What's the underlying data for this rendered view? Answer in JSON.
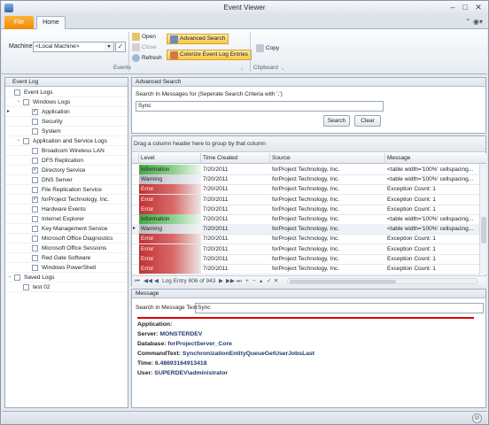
{
  "window": {
    "title": "Event Viewer"
  },
  "tabs": {
    "file": "File",
    "home": "Home"
  },
  "ribbon": {
    "machine_label": "Machine",
    "machine_value": "<Local Machine>",
    "open": "Open",
    "close": "Close",
    "refresh": "Refresh",
    "advanced_search": "Advanced Search",
    "colorize": "Colorize Event Log Entries",
    "copy": "Copy",
    "events_group": "Events",
    "clipboard_group": "Clipboard"
  },
  "event_log": {
    "header": "Event Log",
    "items": [
      {
        "label": "Event Logs",
        "depth": 0,
        "checked": false,
        "expander": ""
      },
      {
        "label": "Windows Logs",
        "depth": 1,
        "checked": false,
        "expander": "−"
      },
      {
        "label": "Application",
        "depth": 2,
        "checked": true,
        "expander": ""
      },
      {
        "label": "Security",
        "depth": 2,
        "checked": false,
        "expander": ""
      },
      {
        "label": "System",
        "depth": 2,
        "checked": false,
        "expander": ""
      },
      {
        "label": "Application and Service Logs",
        "depth": 1,
        "checked": false,
        "expander": "−"
      },
      {
        "label": "Broadcom Wireless LAN",
        "depth": 2,
        "checked": false,
        "expander": ""
      },
      {
        "label": "DFS Replication",
        "depth": 2,
        "checked": false,
        "expander": ""
      },
      {
        "label": "Directory Service",
        "depth": 2,
        "checked": true,
        "expander": ""
      },
      {
        "label": "DNS Server",
        "depth": 2,
        "checked": false,
        "expander": ""
      },
      {
        "label": "File Replication Service",
        "depth": 2,
        "checked": false,
        "expander": ""
      },
      {
        "label": "forProject Technology, Inc.",
        "depth": 2,
        "checked": true,
        "expander": ""
      },
      {
        "label": "Hardware Events",
        "depth": 2,
        "checked": false,
        "expander": ""
      },
      {
        "label": "Internet Explorer",
        "depth": 2,
        "checked": false,
        "expander": ""
      },
      {
        "label": "Key Management Service",
        "depth": 2,
        "checked": false,
        "expander": ""
      },
      {
        "label": "Microsoft Office Diagnostics",
        "depth": 2,
        "checked": false,
        "expander": ""
      },
      {
        "label": "Microsoft Office Sessions",
        "depth": 2,
        "checked": false,
        "expander": ""
      },
      {
        "label": "Red Gate Software",
        "depth": 2,
        "checked": false,
        "expander": ""
      },
      {
        "label": "Windows PowerShell",
        "depth": 2,
        "checked": false,
        "expander": ""
      },
      {
        "label": "Saved Logs",
        "depth": 0,
        "checked": false,
        "expander": "−"
      },
      {
        "label": "test 02",
        "depth": 1,
        "checked": false,
        "expander": ""
      }
    ]
  },
  "advanced_search": {
    "header": "Advanced Search",
    "label": "Search In Messages for (Seperate Search Criteria with ',')",
    "value": "Sync",
    "search_button": "Search",
    "clear_button": "Clear"
  },
  "grid": {
    "group_hint": "Drag a column header here to group by that column",
    "columns": [
      "Level",
      "Time Created",
      "Source",
      "Message"
    ],
    "rows": [
      {
        "level": "Information",
        "time": "7/20/2011",
        "source": "forProject Technology, Inc.",
        "message": "<table width='100%' cellspacing..."
      },
      {
        "level": "Warning",
        "time": "7/20/2011",
        "source": "forProject Technology, Inc.",
        "message": "<table width='100%' cellspacing..."
      },
      {
        "level": "Error",
        "time": "7/20/2011",
        "source": "forProject Technology, Inc.",
        "message": "Exception Count: 1"
      },
      {
        "level": "Error",
        "time": "7/20/2011",
        "source": "forProject Technology, Inc.",
        "message": "Exception Count: 1"
      },
      {
        "level": "Error",
        "time": "7/20/2011",
        "source": "forProject Technology, Inc.",
        "message": "Exception Count: 1"
      },
      {
        "level": "Information",
        "time": "7/20/2011",
        "source": "forProject Technology, Inc.",
        "message": "<table width='100%' cellspacing..."
      },
      {
        "level": "Warning",
        "time": "7/20/2011",
        "source": "forProject Technology, Inc.",
        "message": "<table width='100%' cellspacing..."
      },
      {
        "level": "Error",
        "time": "7/20/2011",
        "source": "forProject Technology, Inc.",
        "message": "Exception Count: 1"
      },
      {
        "level": "Error",
        "time": "7/20/2011",
        "source": "forProject Technology, Inc.",
        "message": "Exception Count: 1"
      },
      {
        "level": "Error",
        "time": "7/20/2011",
        "source": "forProject Technology, Inc.",
        "message": "Exception Count: 1"
      },
      {
        "level": "Error",
        "time": "7/20/2011",
        "source": "forProject Technology, Inc.",
        "message": "Exception Count: 1"
      }
    ],
    "nav_text": "Log Entry 806 of 943"
  },
  "message": {
    "header": "Message",
    "search_label": "Search in Message Text",
    "search_value": "Sync",
    "lines": [
      {
        "key": "Application:",
        "value": ""
      },
      {
        "key": "Server:",
        "value": "MONSTERDEV"
      },
      {
        "key": "Database:",
        "value": "forProjectServer_Core"
      },
      {
        "key": "CommandText:",
        "value": "SynchronizationEntityQueueGetUserJobsLast"
      },
      {
        "key": "Time:",
        "value": "6.48693164913418"
      },
      {
        "key": "User:",
        "value": "SUPERDEV\\administrator"
      }
    ]
  },
  "colors": {
    "file_tab": "#f0900f",
    "highlight": "#f9c64a",
    "error": "#c23030",
    "information": "#45a845",
    "warning": "#b9bcc2",
    "accent_red_line": "#d80000"
  }
}
